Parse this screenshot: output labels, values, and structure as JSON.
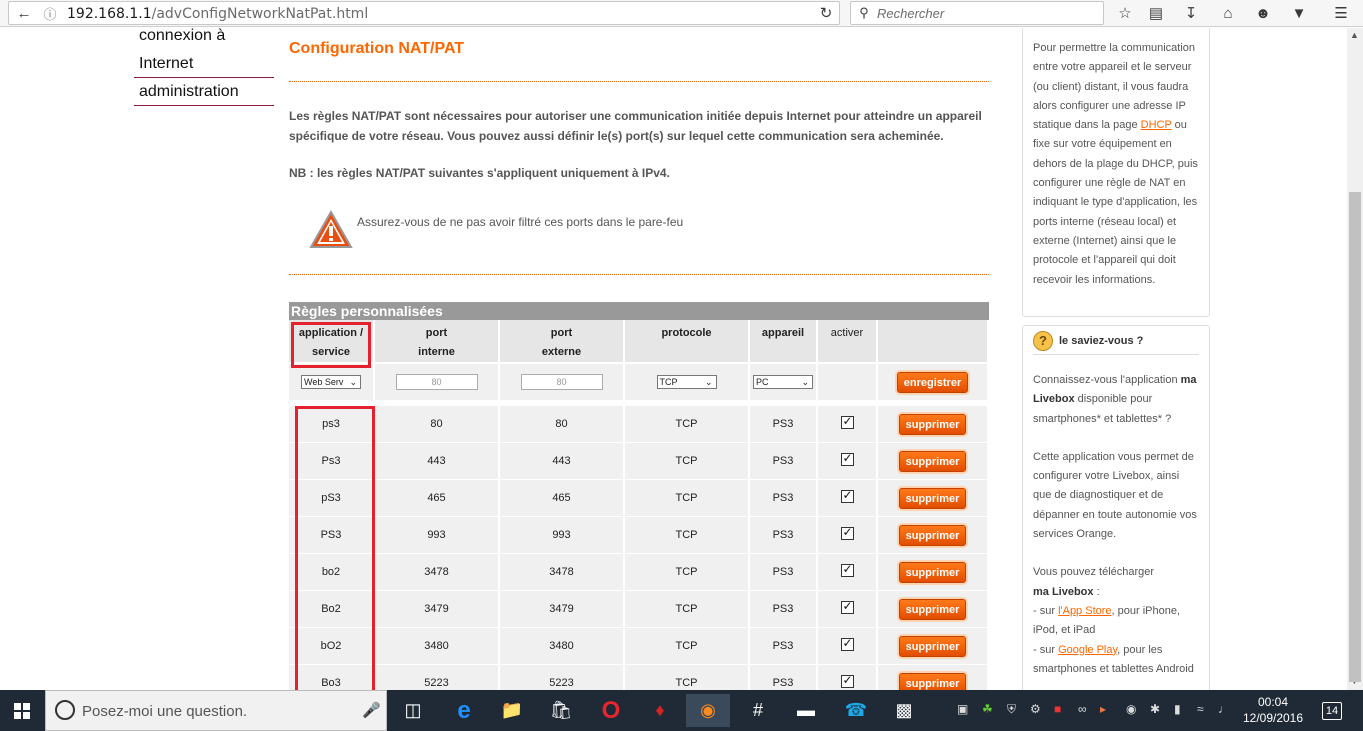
{
  "browser": {
    "url_host": "192.168.1.1",
    "url_path": "/advConfigNetworkNatPat.html",
    "search_placeholder": "Rechercher"
  },
  "left_nav": {
    "items": [
      "connexion à",
      "Internet",
      "administration"
    ]
  },
  "main": {
    "title": "Configuration NAT/PAT",
    "intro": "Les règles NAT/PAT sont nécessaires pour autoriser une communication initiée depuis Internet pour atteindre un appareil spécifique de votre réseau. Vous pouvez aussi définir le(s) port(s) sur lequel cette communication sera acheminée.",
    "nb": "NB : les règles NAT/PAT suivantes s'appliquent uniquement à IPv4.",
    "warning": "Assurez-vous de ne pas avoir filtré ces ports dans le pare-feu"
  },
  "rules_table": {
    "title": "Règles personnalisées",
    "headers": {
      "app1": "application /",
      "app2": "service",
      "pi1": "port",
      "pi2": "interne",
      "pe1": "port",
      "pe2": "externe",
      "proto": "protocole",
      "device": "appareil",
      "active": "activer"
    },
    "input_row": {
      "service": "Web Serv",
      "internal_port": "80",
      "external_port": "80",
      "protocol": "TCP",
      "device": "PC",
      "save_label": "enregistrer"
    },
    "delete_label": "supprimer",
    "rows": [
      {
        "service": "ps3",
        "internal": "80",
        "external": "80",
        "protocol": "TCP",
        "device": "PS3"
      },
      {
        "service": "Ps3",
        "internal": "443",
        "external": "443",
        "protocol": "TCP",
        "device": "PS3"
      },
      {
        "service": "pS3",
        "internal": "465",
        "external": "465",
        "protocol": "TCP",
        "device": "PS3"
      },
      {
        "service": "PS3",
        "internal": "993",
        "external": "993",
        "protocol": "TCP",
        "device": "PS3"
      },
      {
        "service": "bo2",
        "internal": "3478",
        "external": "3478",
        "protocol": "TCP",
        "device": "PS3"
      },
      {
        "service": "Bo2",
        "internal": "3479",
        "external": "3479",
        "protocol": "TCP",
        "device": "PS3"
      },
      {
        "service": "bO2",
        "internal": "3480",
        "external": "3480",
        "protocol": "TCP",
        "device": "PS3"
      },
      {
        "service": "Bo3",
        "internal": "5223",
        "external": "5223",
        "protocol": "TCP",
        "device": "PS3"
      }
    ]
  },
  "sidebar": {
    "help_p1a": "Pour permettre la communication entre votre appareil et le serveur (ou client) distant, il vous faudra alors configurer une adresse IP statique dans la page ",
    "help_link": "DHCP",
    "help_p1b": " ou fixe sur votre équipement en dehors de la plage du DHCP, puis configurer une règle de NAT en indiquant le type d'application, les ports interne (réseau local) et externe (Internet) ainsi que le protocole et l'appareil qui doit recevoir les informations.",
    "tip_title": "le saviez-vous ?",
    "tip_p1a": "Connaissez-vous l'application ",
    "tip_p1b": "ma Livebox",
    "tip_p1c": " disponible pour smartphones* et tablettes* ?",
    "tip_p2": "Cette application vous permet de configurer votre Livebox, ainsi que de diagnostiquer et de dépanner en toute autonomie vos services Orange.",
    "tip_p3a": "Vous pouvez télécharger",
    "tip_p3b": "ma Livebox",
    "tip_p3c": " :",
    "tip_l1a": "- sur ",
    "tip_l1link": "l'App Store",
    "tip_l1b": ", pour iPhone, iPod, et iPad",
    "tip_l2a": "- sur ",
    "tip_l2link": "Google Play",
    "tip_l2b": ", pour les smartphones et tablettes Android"
  },
  "taskbar": {
    "cortana_placeholder": "Posez-moi une question.",
    "time": "00:04",
    "date": "12/09/2016",
    "notifications": "14"
  },
  "colors": {
    "orange": "#ff6600",
    "table_header_bg": "#999999",
    "highlight_red": "#e4212e"
  }
}
